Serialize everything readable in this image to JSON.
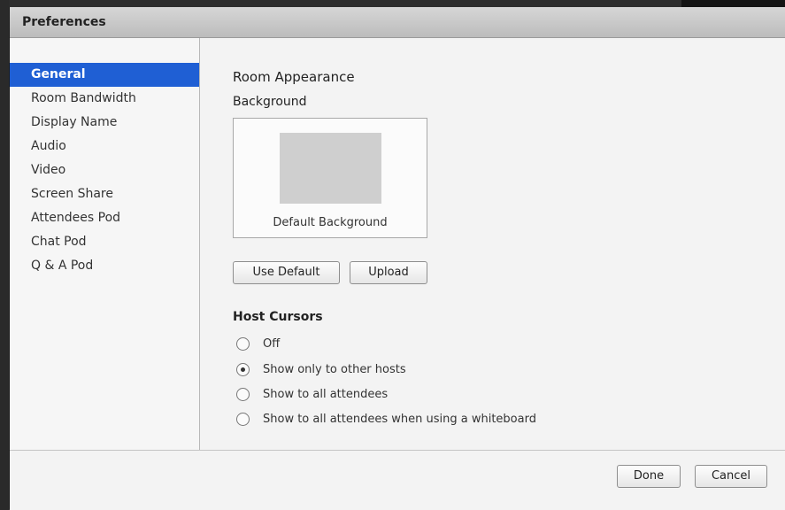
{
  "window": {
    "title": "Preferences"
  },
  "sidebar": {
    "items": [
      {
        "label": "General",
        "selected": true
      },
      {
        "label": "Room Bandwidth",
        "selected": false
      },
      {
        "label": "Display Name",
        "selected": false
      },
      {
        "label": "Audio",
        "selected": false
      },
      {
        "label": "Video",
        "selected": false
      },
      {
        "label": "Screen Share",
        "selected": false
      },
      {
        "label": "Attendees Pod",
        "selected": false
      },
      {
        "label": "Chat Pod",
        "selected": false
      },
      {
        "label": "Q & A Pod",
        "selected": false
      }
    ]
  },
  "room_appearance": {
    "title": "Room Appearance",
    "background_label": "Background",
    "preview_caption": "Default Background",
    "use_default_label": "Use Default",
    "upload_label": "Upload"
  },
  "host_cursors": {
    "title": "Host Cursors",
    "options": [
      {
        "label": "Off",
        "checked": false
      },
      {
        "label": "Show only to other hosts",
        "checked": true
      },
      {
        "label": "Show to all attendees",
        "checked": false
      },
      {
        "label": "Show to all attendees when using a whiteboard",
        "checked": false
      }
    ]
  },
  "footer": {
    "done_label": "Done",
    "cancel_label": "Cancel"
  },
  "colors": {
    "selection": "#1f5fd4",
    "titlebar": "#c8c8c8",
    "panel": "#f3f3f3"
  }
}
